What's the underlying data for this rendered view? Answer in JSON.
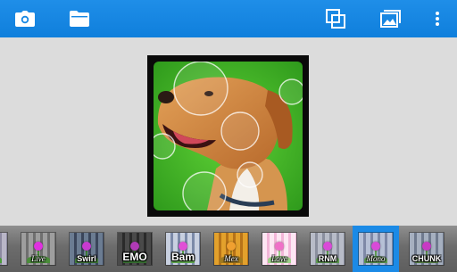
{
  "toolbar": {
    "icons": [
      "camera-icon",
      "folder-icon",
      "crop-icon",
      "gallery-icon",
      "more-vert-icon"
    ],
    "accent": "#1589e5"
  },
  "filters": {
    "items": [
      {
        "label": ""
      },
      {
        "label": "Live"
      },
      {
        "label": "Swirl"
      },
      {
        "label": "EMO"
      },
      {
        "label": "Bam"
      },
      {
        "label": "Mex"
      },
      {
        "label": "Love"
      },
      {
        "label": "RNM"
      },
      {
        "label": "Mono"
      },
      {
        "label": "CHUNK"
      }
    ],
    "selected": "Mono"
  }
}
